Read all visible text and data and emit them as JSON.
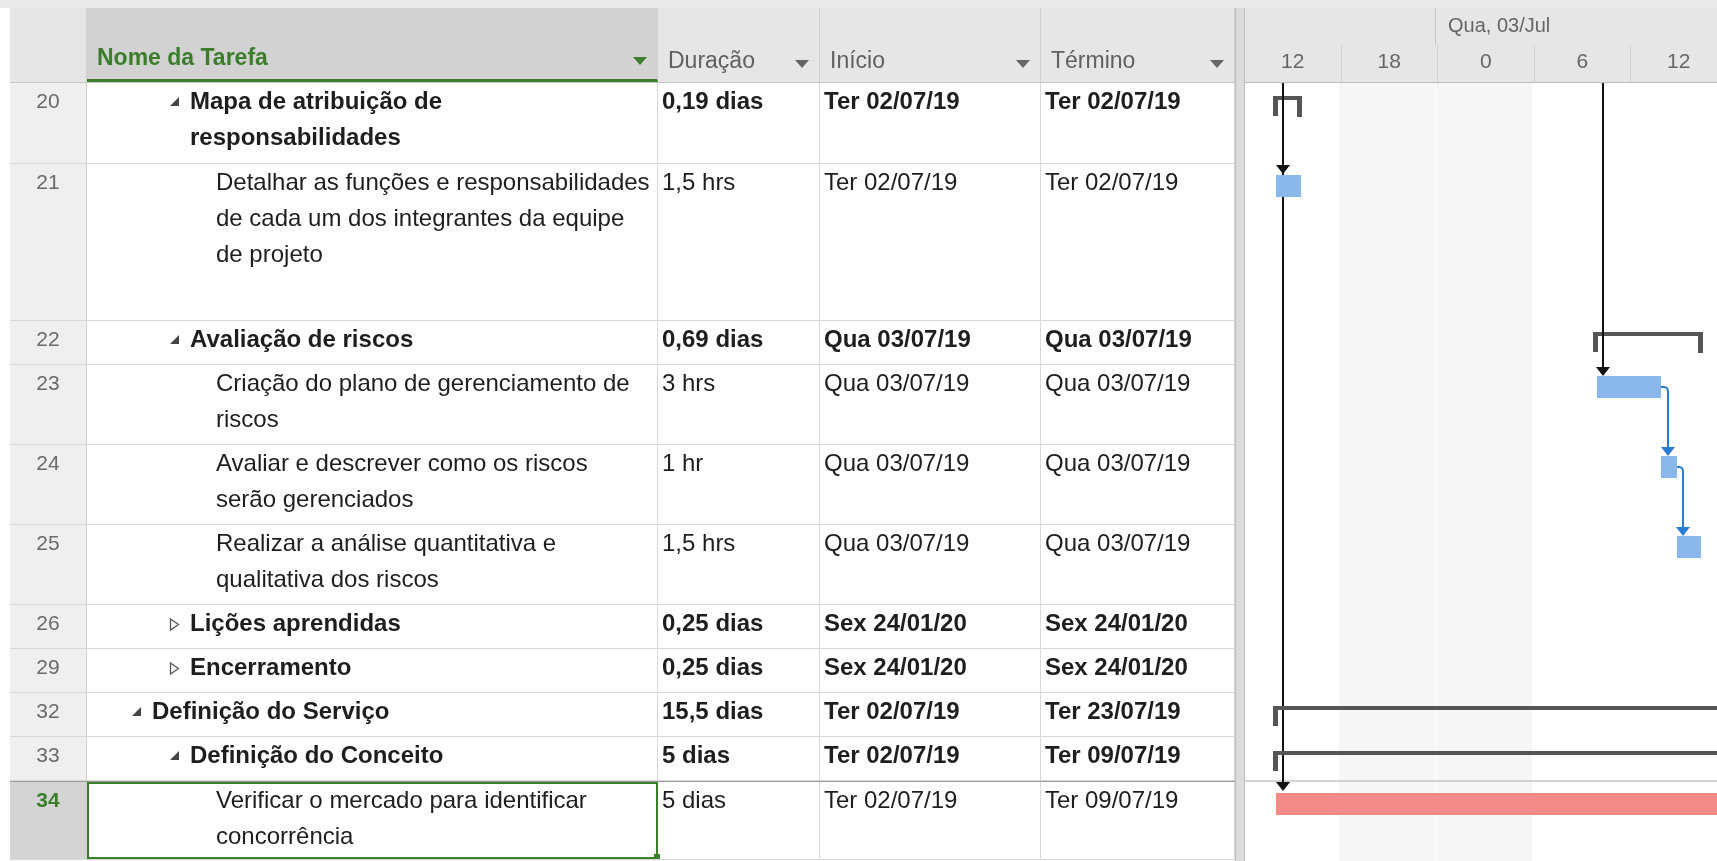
{
  "columns": [
    {
      "label": "Nome da Tarefa",
      "selected": true
    },
    {
      "label": "Duração",
      "selected": false
    },
    {
      "label": "Início",
      "selected": false
    },
    {
      "label": "Término",
      "selected": false
    }
  ],
  "timescale": {
    "top_label": "Qua, 03/Jul",
    "ticks": [
      "12",
      "18",
      "0",
      "6",
      "12"
    ]
  },
  "rows": [
    {
      "children": [
        {
          "id": "20",
          "kind": "summary",
          "expanded": true,
          "name": "Mapa de atribuição de responsabilidades",
          "duration": "0,19 dias",
          "start": "Ter 02/07/19",
          "finish": "Ter 02/07/19",
          "selected": false,
          "children": [
            {
              "id": "21",
              "kind": "task",
              "name": "Detalhar as funções e responsabilidades de cada um dos integrantes da equipe de projeto",
              "duration": "1,5 hrs",
              "start": "Ter 02/07/19",
              "finish": "Ter 02/07/19",
              "selected": false
            }
          ]
        },
        {
          "id": "22",
          "kind": "summary",
          "expanded": true,
          "name": "Avaliação de riscos",
          "duration": "0,69 dias",
          "start": "Qua 03/07/19",
          "finish": "Qua 03/07/19",
          "selected": false,
          "children": [
            {
              "id": "23",
              "kind": "task",
              "name": "Criação do plano de gerenciamento de riscos",
              "duration": "3 hrs",
              "start": "Qua 03/07/19",
              "finish": "Qua 03/07/19",
              "selected": false
            },
            {
              "id": "24",
              "kind": "task",
              "name": "Avaliar e descrever como os riscos serão gerenciados",
              "duration": "1 hr",
              "start": "Qua 03/07/19",
              "finish": "Qua 03/07/19",
              "selected": false
            },
            {
              "id": "25",
              "kind": "task",
              "name": "Realizar a análise quantitativa e qualitativa dos riscos",
              "duration": "1,5 hrs",
              "start": "Qua 03/07/19",
              "finish": "Qua 03/07/19",
              "selected": false
            }
          ]
        },
        {
          "id": "26",
          "kind": "summary",
          "expanded": false,
          "name": "Lições aprendidas",
          "duration": "0,25 dias",
          "start": "Sex 24/01/20",
          "finish": "Sex 24/01/20",
          "selected": false
        },
        {
          "id": "29",
          "kind": "summary",
          "expanded": false,
          "name": "Encerramento",
          "duration": "0,25 dias",
          "start": "Sex 24/01/20",
          "finish": "Sex 24/01/20",
          "selected": false
        }
      ]
    },
    {
      "id": "32",
      "kind": "summary",
      "expanded": true,
      "name": "Definição do Serviço",
      "duration": "15,5 dias",
      "start": "Ter 02/07/19",
      "finish": "Ter 23/07/19",
      "selected": false,
      "children": [
        {
          "id": "33",
          "kind": "summary",
          "expanded": true,
          "name": "Definição do Conceito",
          "duration": "5 dias",
          "start": "Ter 02/07/19",
          "finish": "Ter 09/07/19",
          "selected": false,
          "children": [
            {
              "id": "34",
              "kind": "task",
              "name": "Verificar o mercado para identificar concorrência",
              "duration": "5 dias",
              "start": "Ter 02/07/19",
              "finish": "Ter 09/07/19",
              "selected": true
            }
          ]
        }
      ]
    }
  ]
}
